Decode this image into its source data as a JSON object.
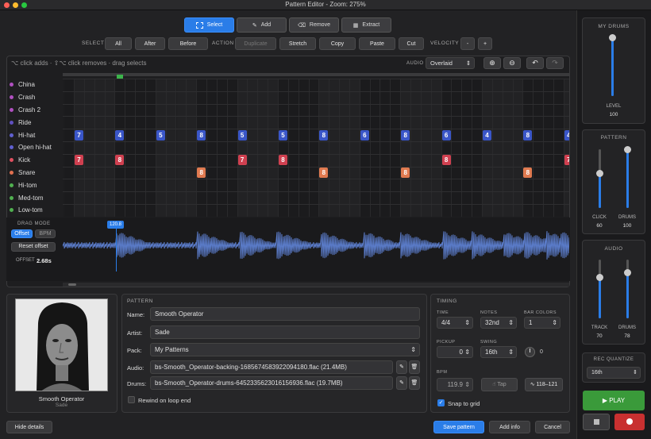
{
  "window": {
    "title": "Pattern Editor - Zoom: 275%"
  },
  "toolbar": {
    "select": "Select",
    "add": "Add",
    "remove": "Remove",
    "extract": "Extract"
  },
  "select_row": {
    "label": "SELECT",
    "all": "All",
    "after": "After",
    "before": "Before"
  },
  "action_row": {
    "label": "ACTION",
    "duplicate": "Duplicate",
    "stretch": "Stretch",
    "copy": "Copy",
    "paste": "Paste",
    "cut": "Cut"
  },
  "velocity": {
    "label": "VELOCITY",
    "minus": "-",
    "plus": "+"
  },
  "hint": "⌥ click adds · ⇧⌥ click removes · drag selects",
  "audio": {
    "label": "AUDIO",
    "mode": "Overlaid"
  },
  "tracks": [
    {
      "name": "China",
      "color": "#b050c0"
    },
    {
      "name": "Crash",
      "color": "#b050c0"
    },
    {
      "name": "Crash 2",
      "color": "#b050c0"
    },
    {
      "name": "Ride",
      "color": "#6050c0"
    },
    {
      "name": "Hi-hat",
      "color": "#6060d0"
    },
    {
      "name": "Open hi-hat",
      "color": "#6060d0"
    },
    {
      "name": "Kick",
      "color": "#e05060"
    },
    {
      "name": "Snare",
      "color": "#e07050"
    },
    {
      "name": "Hi-tom",
      "color": "#50b050"
    },
    {
      "name": "Med-tom",
      "color": "#50b050"
    },
    {
      "name": "Low-tom",
      "color": "#50b050"
    }
  ],
  "notes": [
    {
      "track": 4,
      "col": 0,
      "v": "7"
    },
    {
      "track": 4,
      "col": 2,
      "v": "4"
    },
    {
      "track": 4,
      "col": 4,
      "v": "5"
    },
    {
      "track": 4,
      "col": 6,
      "v": "8"
    },
    {
      "track": 4,
      "col": 8,
      "v": "5"
    },
    {
      "track": 4,
      "col": 10,
      "v": "5"
    },
    {
      "track": 4,
      "col": 12,
      "v": "8"
    },
    {
      "track": 4,
      "col": 14,
      "v": "6"
    },
    {
      "track": 4,
      "col": 16,
      "v": "8"
    },
    {
      "track": 4,
      "col": 18,
      "v": "6"
    },
    {
      "track": 4,
      "col": 20,
      "v": "4"
    },
    {
      "track": 4,
      "col": 22,
      "v": "8"
    },
    {
      "track": 4,
      "col": 24,
      "v": "4"
    },
    {
      "track": 6,
      "col": 0,
      "v": "7"
    },
    {
      "track": 6,
      "col": 2,
      "v": "8"
    },
    {
      "track": 6,
      "col": 8,
      "v": "7"
    },
    {
      "track": 6,
      "col": 10,
      "v": "8"
    },
    {
      "track": 6,
      "col": 18,
      "v": "8"
    },
    {
      "track": 6,
      "col": 24,
      "v": "7"
    },
    {
      "track": 7,
      "col": 6,
      "v": "8"
    },
    {
      "track": 7,
      "col": 12,
      "v": "8"
    },
    {
      "track": 7,
      "col": 16,
      "v": "8"
    },
    {
      "track": 7,
      "col": 22,
      "v": "8"
    }
  ],
  "waveform": {
    "marker": "120.8"
  },
  "drag_mode": {
    "label": "DRAG MODE",
    "offset": "Offset",
    "bpm": "BPM",
    "reset": "Reset offset",
    "offset_label": "OFFSET",
    "offset_value": "2.68s"
  },
  "album": {
    "title": "Smooth Operator",
    "artist": "Sade"
  },
  "pattern": {
    "section": "PATTERN",
    "name_label": "Name:",
    "name": "Smooth Operator",
    "artist_label": "Artist:",
    "artist": "Sade",
    "pack_label": "Pack:",
    "pack": "My Patterns",
    "audio_label": "Audio:",
    "audio": "bs-Smooth_Operator-backing-1685674583922094180.flac (21.4MB)",
    "drums_label": "Drums:",
    "drums": "bs-Smooth_Operator-drums-6452335623016156936.flac (19.7MB)",
    "rewind": "Rewind on loop end"
  },
  "timing": {
    "section": "TIMING",
    "time_label": "TIME",
    "time": "4/4",
    "notes_label": "NOTES",
    "notes": "32nd",
    "barcolors_label": "BAR COLORS",
    "barcolors": "1",
    "pickup_label": "PICKUP",
    "pickup": "0",
    "swing_label": "SWING",
    "swing": "16th",
    "swing_value": "0",
    "bpm_label": "BPM",
    "bpm": "119.9",
    "tap": "Tap",
    "bpm_range": "118–121",
    "snap": "Snap to grid"
  },
  "sidebar": {
    "mydrums": "MY DRUMS",
    "level_label": "LEVEL",
    "level": "100",
    "level_fill": 1.0,
    "pattern": "PATTERN",
    "click_label": "CLICK",
    "click": "60",
    "click_fill": 0.6,
    "drums_label": "DRUMS",
    "drums": "100",
    "drums_fill": 1.0,
    "audio": "AUDIO",
    "track_label": "TRACK",
    "track": "70",
    "track_fill": 0.7,
    "drums2_label": "DRUMS",
    "drums2": "78",
    "drums2_fill": 0.78,
    "rec_quantize": "REC QUANTIZE",
    "rq_value": "16th",
    "play": "PLAY"
  },
  "footer": {
    "hide": "Hide details",
    "save": "Save pattern",
    "add_info": "Add info",
    "cancel": "Cancel"
  },
  "colors": {
    "accent": "#2a7de8",
    "hihat": "#3a56c8",
    "kick": "#d04050",
    "snare": "#e07a50",
    "play": "#3a9a3a",
    "record": "#c83030"
  }
}
